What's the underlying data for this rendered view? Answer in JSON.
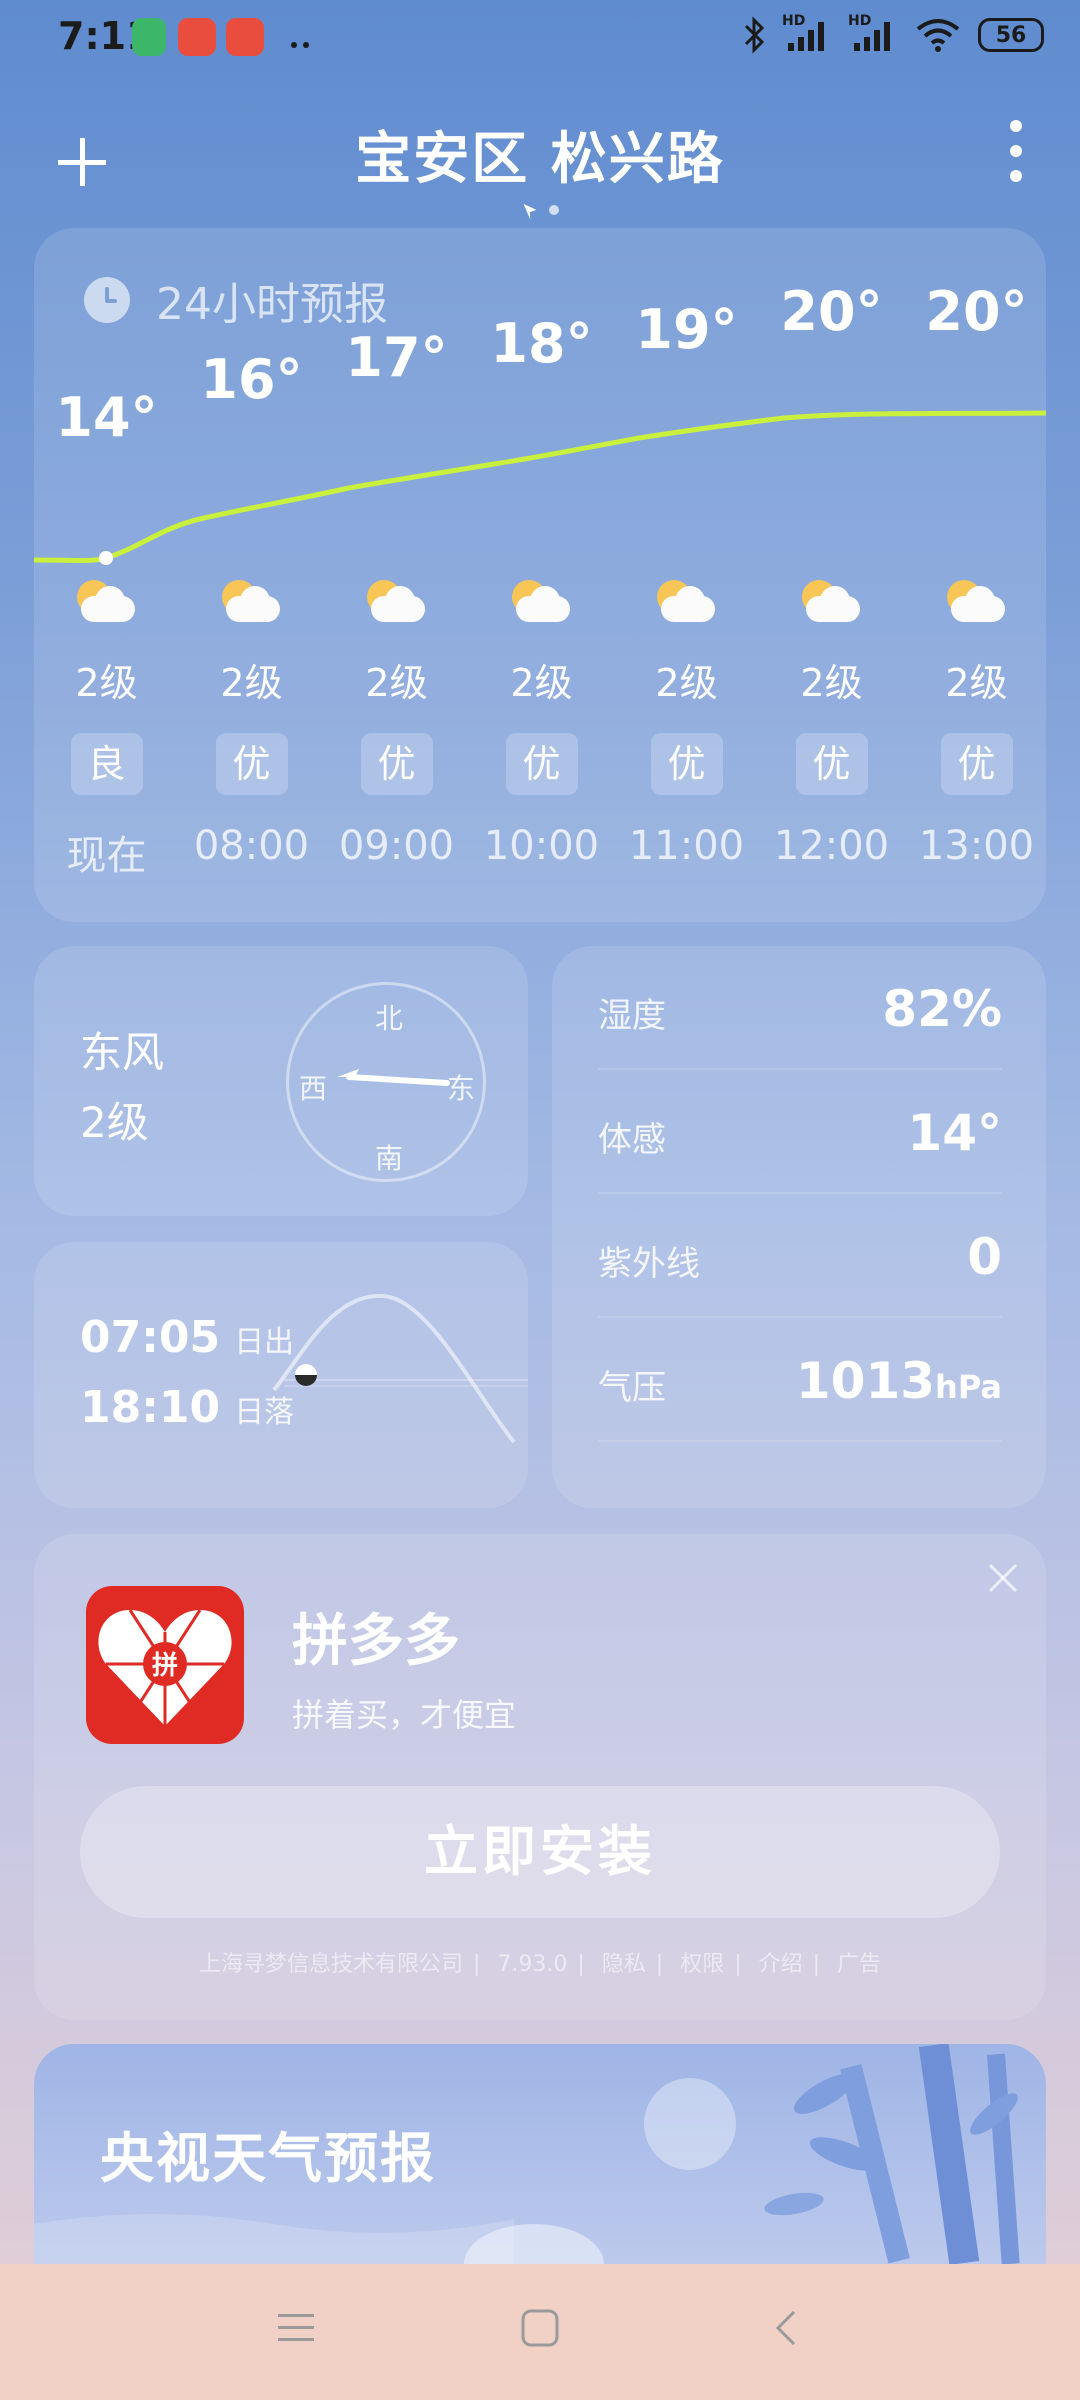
{
  "status_bar": {
    "time": "7:11",
    "network_badges": [
      "HD",
      "HD"
    ],
    "battery": "56"
  },
  "header": {
    "add_icon": "plus-icon",
    "title": "宝安区 松兴路",
    "more_icon": "more-vertical-icon",
    "page_indicator": "location-arrow-icon"
  },
  "forecast": {
    "title": "24小时预报",
    "icon": "clock-icon",
    "hours": [
      {
        "time": "现在",
        "temp": "14°",
        "wind": "2级",
        "aqi": "良",
        "weather_icon": "partly-cloudy-icon"
      },
      {
        "time": "08:00",
        "temp": "16°",
        "wind": "2级",
        "aqi": "优",
        "weather_icon": "partly-cloudy-icon"
      },
      {
        "time": "09:00",
        "temp": "17°",
        "wind": "2级",
        "aqi": "优",
        "weather_icon": "partly-cloudy-icon"
      },
      {
        "time": "10:00",
        "temp": "18°",
        "wind": "2级",
        "aqi": "优",
        "weather_icon": "partly-cloudy-icon"
      },
      {
        "time": "11:00",
        "temp": "19°",
        "wind": "2级",
        "aqi": "优",
        "weather_icon": "partly-cloudy-icon"
      },
      {
        "time": "12:00",
        "temp": "20°",
        "wind": "2级",
        "aqi": "优",
        "weather_icon": "partly-cloudy-icon"
      },
      {
        "time": "13:00",
        "temp": "20°",
        "wind": "2级",
        "aqi": "优",
        "weather_icon": "partly-cloudy-icon"
      }
    ],
    "line_color": "#c8f03c"
  },
  "wind": {
    "direction": "东风",
    "level": "2级",
    "compass": {
      "north": "北",
      "south": "南",
      "east": "东",
      "west": "西"
    }
  },
  "sun": {
    "sunrise_time": "07:05",
    "sunrise_label": "日出",
    "sunset_time": "18:10",
    "sunset_label": "日落"
  },
  "details": {
    "humidity_label": "湿度",
    "humidity_value": "82%",
    "feels_label": "体感",
    "feels_value": "14°",
    "uv_label": "紫外线",
    "uv_value": "0",
    "pressure_label": "气压",
    "pressure_value": "1013",
    "pressure_unit": "hPa"
  },
  "ad": {
    "app_name": "拼多多",
    "slogan": "拼着买，才便宜",
    "install_label": "立即安装",
    "close_icon": "close-icon",
    "logo_char": "拼",
    "footer": [
      "上海寻梦信息技术有限公司",
      "7.93.0",
      "隐私",
      "权限",
      "介绍",
      "广告"
    ]
  },
  "cctv": {
    "title": "央视天气预报"
  },
  "navbar": {
    "icons": [
      "menu-icon",
      "home-icon",
      "back-icon"
    ]
  }
}
